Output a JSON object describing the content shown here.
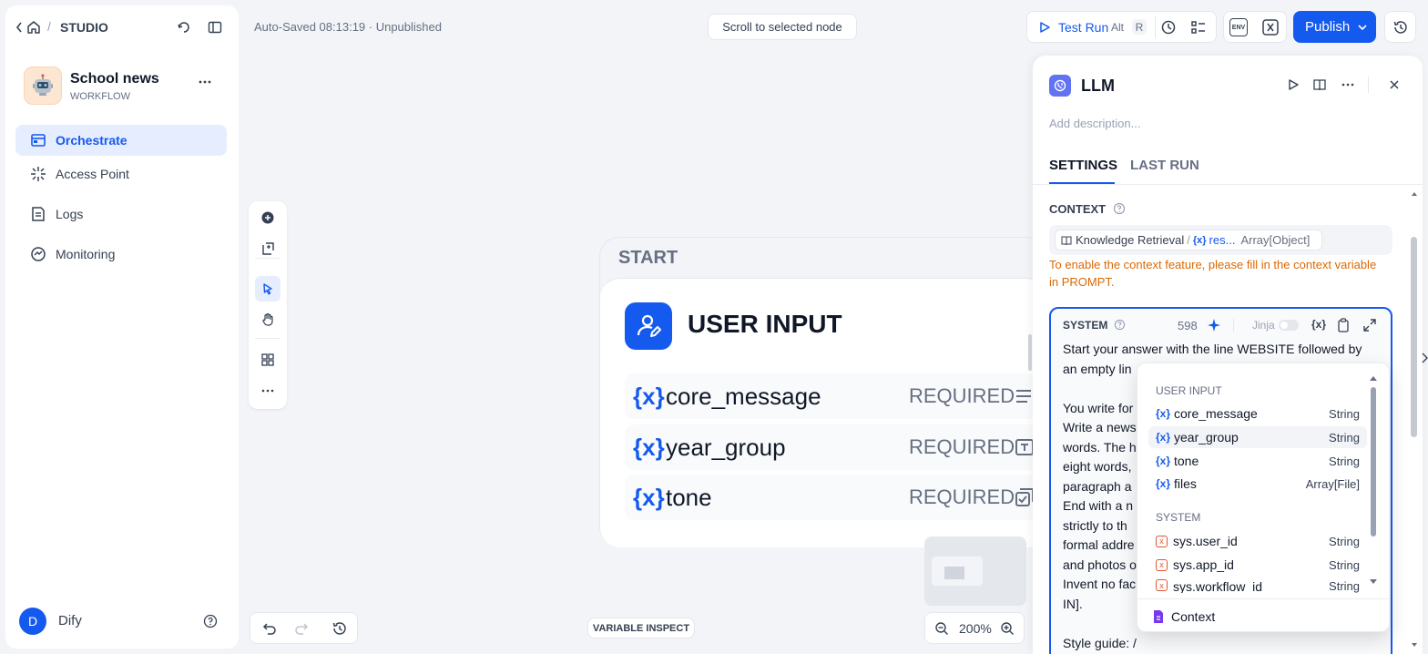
{
  "sidebar": {
    "breadcrumb": "STUDIO",
    "app_name": "School news",
    "app_type": "WORKFLOW",
    "nav": [
      {
        "label": "Orchestrate"
      },
      {
        "label": "Access Point"
      },
      {
        "label": "Logs"
      },
      {
        "label": "Monitoring"
      }
    ],
    "user_initial": "D",
    "user_name": "Dify"
  },
  "header": {
    "autosave": "Auto-Saved 08:13:19 · Unpublished",
    "scroll_to_node": "Scroll to selected node",
    "test_run": "Test Run",
    "shortcut_alt": "Alt",
    "shortcut_r": "R",
    "env_label": "ENV",
    "publish": "Publish"
  },
  "node": {
    "header": "START",
    "title": "USER INPUT",
    "variables": [
      {
        "name": "core_message",
        "required": "REQUIRED"
      },
      {
        "name": "year_group",
        "required": "REQUIRED"
      },
      {
        "name": "tone",
        "required": "REQUIRED"
      }
    ],
    "var_icon": "{x}"
  },
  "canvas": {
    "variable_inspect": "VARIABLE INSPECT",
    "zoom": "200%"
  },
  "panel": {
    "title": "LLM",
    "description_placeholder": "Add description...",
    "tabs": [
      "SETTINGS",
      "LAST RUN"
    ],
    "context_label": "CONTEXT",
    "context_source": "Knowledge Retrieval",
    "context_var": "res...",
    "context_type": "Array[Object]",
    "context_warning": "To enable the context feature, please fill in the context variable in PROMPT.",
    "system_label": "SYSTEM",
    "token_count": "598",
    "jinja_label": "Jinja",
    "prompt_lines": [
      "Start your answer with the line WEBSITE followed by",
      "an empty lin",
      "",
      "You write for",
      "Write a news",
      "words. The h",
      "eight words,",
      "paragraph a",
      "End with a n",
      "strictly to th",
      "formal addre",
      "and photos o",
      "Invent no fac",
      "IN].",
      "",
      "Style guide: /"
    ]
  },
  "dropdown": {
    "group_user": "USER INPUT",
    "user_vars": [
      {
        "name": "core_message",
        "type": "String"
      },
      {
        "name": "year_group",
        "type": "String"
      },
      {
        "name": "tone",
        "type": "String"
      },
      {
        "name": "files",
        "type": "Array[File]"
      }
    ],
    "group_system": "SYSTEM",
    "system_vars": [
      {
        "name": "sys.user_id",
        "type": "String"
      },
      {
        "name": "sys.app_id",
        "type": "String"
      },
      {
        "name": "sys.workflow_id",
        "type": "String"
      }
    ],
    "context_item": "Context"
  },
  "colors": {
    "accent": "#155aef",
    "warning": "#dc6803",
    "active_nav_bg": "#e6edff"
  }
}
